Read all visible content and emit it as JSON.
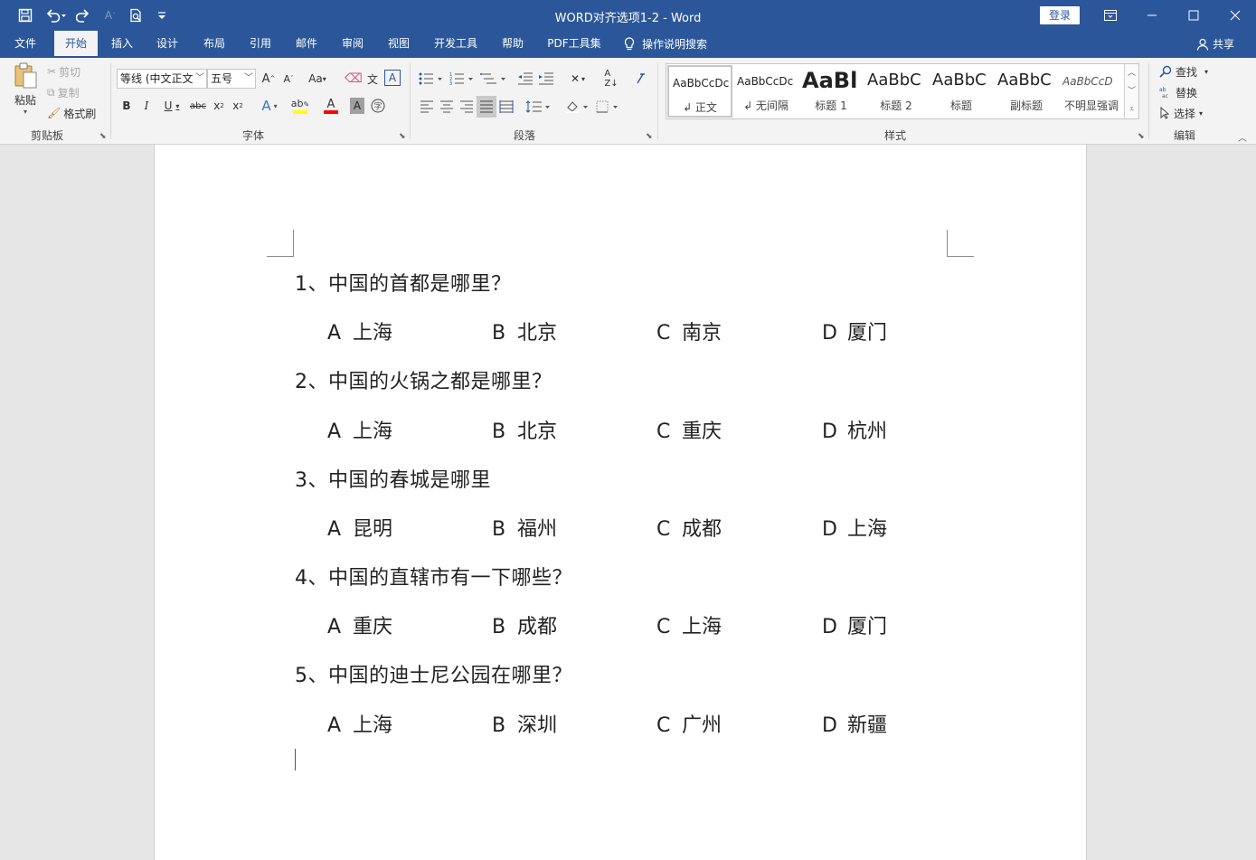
{
  "window": {
    "title": "WORD对齐选项1-2  -  Word",
    "login_label": "登录"
  },
  "quick_access": {
    "icons": [
      "save-icon",
      "undo-icon",
      "redo-icon",
      "font-size-icon",
      "print-preview-icon",
      "customize-icon"
    ]
  },
  "tabs": [
    {
      "label": "文件",
      "active": false
    },
    {
      "label": "开始",
      "active": true
    },
    {
      "label": "插入",
      "active": false
    },
    {
      "label": "设计",
      "active": false
    },
    {
      "label": "布局",
      "active": false
    },
    {
      "label": "引用",
      "active": false
    },
    {
      "label": "邮件",
      "active": false
    },
    {
      "label": "审阅",
      "active": false
    },
    {
      "label": "视图",
      "active": false
    },
    {
      "label": "开发工具",
      "active": false
    },
    {
      "label": "帮助",
      "active": false
    },
    {
      "label": "PDF工具集",
      "active": false
    }
  ],
  "tell_me": "操作说明搜索",
  "share_label": "共享",
  "clipboard": {
    "group_label": "剪贴板",
    "paste": "粘贴",
    "cut": "剪切",
    "copy": "复制",
    "format_painter": "格式刷"
  },
  "font": {
    "group_label": "字体",
    "font_name": "等线 (中文正文",
    "font_size": "五号"
  },
  "paragraph": {
    "group_label": "段落"
  },
  "styles": {
    "group_label": "样式",
    "items": [
      {
        "sample": "AaBbCcDc",
        "name": "↲ 正文"
      },
      {
        "sample": "AaBbCcDc",
        "name": "↲ 无间隔"
      },
      {
        "sample": "AaBl",
        "name": "标题 1"
      },
      {
        "sample": "AaBbC",
        "name": "标题 2"
      },
      {
        "sample": "AaBbC",
        "name": "标题"
      },
      {
        "sample": "AaBbC",
        "name": "副标题"
      },
      {
        "sample": "AaBbCcD",
        "name": "不明显强调"
      }
    ]
  },
  "editing": {
    "group_label": "编辑",
    "find": "查找",
    "replace": "替换",
    "select": "选择"
  },
  "document": {
    "questions": [
      {
        "text": "1、中国的首都是哪里？",
        "options": [
          {
            "letter": "A",
            "text": "上海"
          },
          {
            "letter": "B",
            "text": "北京"
          },
          {
            "letter": "C",
            "text": "南京"
          },
          {
            "letter": "D",
            "text": "厦门"
          }
        ]
      },
      {
        "text": "2、中国的火锅之都是哪里？",
        "options": [
          {
            "letter": "A",
            "text": "上海"
          },
          {
            "letter": "B",
            "text": "北京"
          },
          {
            "letter": "C",
            "text": "重庆"
          },
          {
            "letter": "D",
            "text": "杭州"
          }
        ]
      },
      {
        "text": "3、中国的春城是哪里",
        "options": [
          {
            "letter": "A",
            "text": "昆明"
          },
          {
            "letter": "B",
            "text": "福州"
          },
          {
            "letter": "C",
            "text": "成都"
          },
          {
            "letter": "D",
            "text": "上海"
          }
        ]
      },
      {
        "text": "4、中国的直辖市有一下哪些？",
        "options": [
          {
            "letter": "A",
            "text": "重庆"
          },
          {
            "letter": "B",
            "text": "成都"
          },
          {
            "letter": "C",
            "text": "上海"
          },
          {
            "letter": "D",
            "text": "厦门"
          }
        ]
      },
      {
        "text": "5、中国的迪士尼公园在哪里？",
        "options": [
          {
            "letter": "A",
            "text": "上海"
          },
          {
            "letter": "B",
            "text": "深圳"
          },
          {
            "letter": "C",
            "text": "广州"
          },
          {
            "letter": "D",
            "text": "新疆"
          }
        ]
      }
    ]
  },
  "colors": {
    "title_bar": "#2b579a",
    "ribbon": "#f3f3f3",
    "workspace": "#e6e6e6",
    "page": "#ffffff",
    "highlight_yellow": "#ffff00",
    "font_color_red": "#ff0000"
  }
}
